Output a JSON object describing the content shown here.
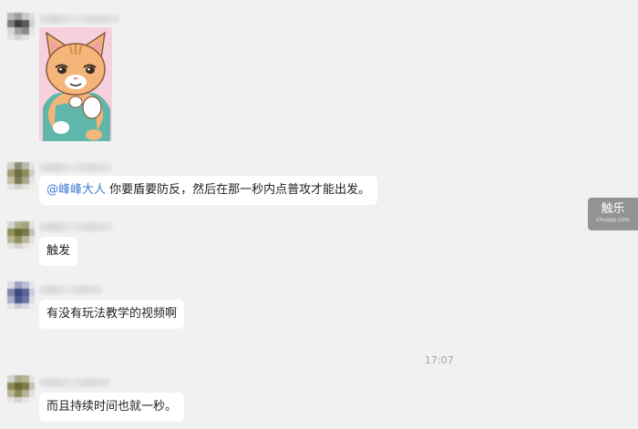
{
  "messages": [
    {
      "text": ""
    },
    {
      "mention": "@峰峰大人",
      "text": " 你要盾要防反，然后在那一秒内点普攻才能出发。"
    },
    {
      "text": "触发"
    },
    {
      "text": "有没有玩法教学的视频啊"
    },
    {
      "text": "而且持续时间也就一秒。"
    }
  ],
  "timestamp": "17:07",
  "watermark": {
    "main": "触乐",
    "sub": "chuapp.com"
  },
  "colors": {
    "background": "#f1f1f1",
    "bubble": "#ffffff",
    "mention": "#3a7bd5",
    "timestamp": "#a5a5a5",
    "watermark_bg": "#8f8f8f"
  },
  "icons": {
    "sticker": "cat-sticker-image"
  }
}
